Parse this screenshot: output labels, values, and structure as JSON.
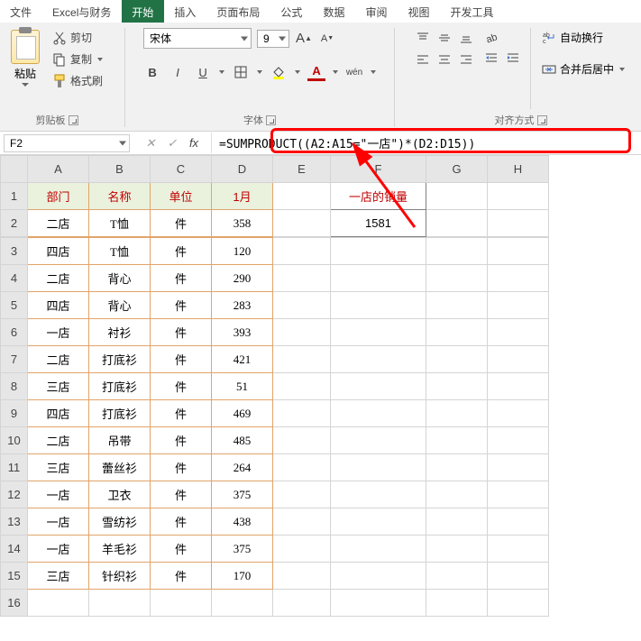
{
  "tabs": [
    "文件",
    "Excel与财务",
    "开始",
    "插入",
    "页面布局",
    "公式",
    "数据",
    "审阅",
    "视图",
    "开发工具"
  ],
  "active_tab_index": 2,
  "ribbon": {
    "clipboard": {
      "paste": "粘贴",
      "cut": "剪切",
      "copy": "复制",
      "format_painter": "格式刷",
      "group": "剪贴板"
    },
    "font": {
      "name": "宋体",
      "size": "9",
      "group": "字体",
      "bold": "B",
      "italic": "I",
      "underline": "U",
      "wen": "wén"
    },
    "align": {
      "wrap": "自动换行",
      "merge": "合并后居中",
      "group": "对齐方式"
    }
  },
  "namebox": "F2",
  "formula_bar": "=SUMPRODUCT((A2:A15=\"一店\")*(D2:D15))",
  "columns": [
    "A",
    "B",
    "C",
    "D",
    "E",
    "F",
    "G",
    "H"
  ],
  "headers": [
    "部门",
    "名称",
    "单位",
    "1月"
  ],
  "f_header": "一店的销量",
  "f_value": "1581",
  "rows": [
    [
      "二店",
      "T恤",
      "件",
      "358"
    ],
    [
      "四店",
      "T恤",
      "件",
      "120"
    ],
    [
      "二店",
      "背心",
      "件",
      "290"
    ],
    [
      "四店",
      "背心",
      "件",
      "283"
    ],
    [
      "一店",
      "衬衫",
      "件",
      "393"
    ],
    [
      "二店",
      "打底衫",
      "件",
      "421"
    ],
    [
      "三店",
      "打底衫",
      "件",
      "51"
    ],
    [
      "四店",
      "打底衫",
      "件",
      "469"
    ],
    [
      "二店",
      "吊带",
      "件",
      "485"
    ],
    [
      "三店",
      "蕾丝衫",
      "件",
      "264"
    ],
    [
      "一店",
      "卫衣",
      "件",
      "375"
    ],
    [
      "一店",
      "雪纺衫",
      "件",
      "438"
    ],
    [
      "一店",
      "羊毛衫",
      "件",
      "375"
    ],
    [
      "三店",
      "针织衫",
      "件",
      "170"
    ]
  ],
  "chart_data": {
    "type": "table",
    "note": "spreadsheet values captured in rows[] above"
  }
}
